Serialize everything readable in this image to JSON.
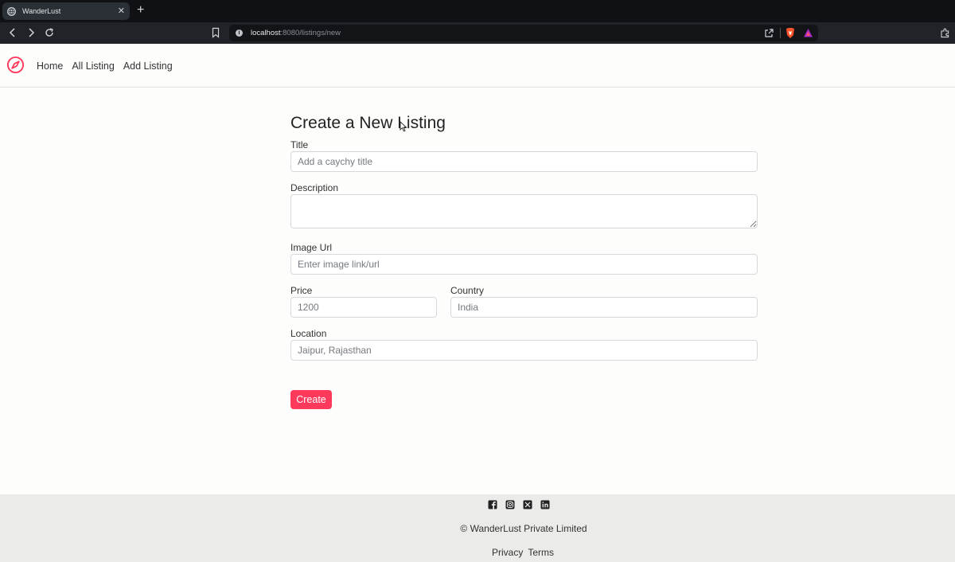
{
  "browser": {
    "tab_title": "WanderLust",
    "url_host": "localhost",
    "url_path": ":8080/listings/new",
    "icons": [
      "back-icon",
      "forward-icon",
      "reload-icon",
      "bookmark-icon",
      "info-icon",
      "share-icon",
      "brave-shields-icon",
      "brave-rewards-icon",
      "extensions-icon"
    ]
  },
  "navbar": {
    "brand_icon": "compass-icon",
    "links": [
      "Home",
      "All Listing",
      "Add Listing"
    ]
  },
  "form": {
    "heading": "Create a New Listing",
    "title": {
      "label": "Title",
      "placeholder": "Add a caychy title"
    },
    "description": {
      "label": "Description",
      "placeholder": ""
    },
    "image": {
      "label": "Image Url",
      "placeholder": "Enter image link/url"
    },
    "price": {
      "label": "Price",
      "placeholder": "1200"
    },
    "country": {
      "label": "Country",
      "placeholder": "India"
    },
    "location": {
      "label": "Location",
      "placeholder": "Jaipur, Rajasthan"
    },
    "submit_label": "Create"
  },
  "footer": {
    "socials": [
      "facebook-icon",
      "instagram-icon",
      "x-icon",
      "linkedin-icon"
    ],
    "copyright": "© WanderLust Private Limited",
    "links": [
      "Privacy",
      "Terms"
    ]
  },
  "colors": {
    "accent": "#fe3a5c",
    "footer_bg": "#ebebe9",
    "chrome_bg": "#202328"
  }
}
